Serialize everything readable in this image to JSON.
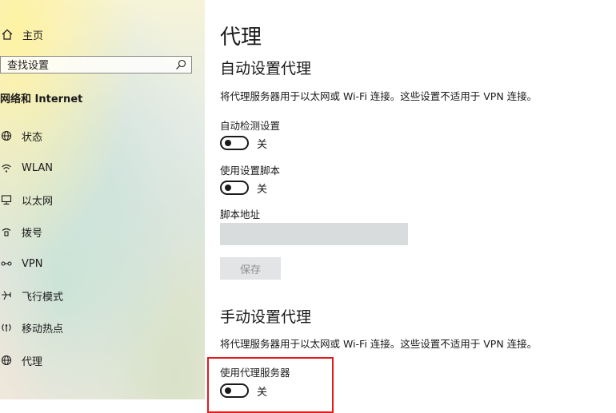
{
  "sidebar": {
    "home_label": "主页",
    "search_placeholder": "查找设置",
    "section_heading": "网络和 Internet",
    "items": [
      {
        "label": "状态",
        "icon": "globe-status-icon"
      },
      {
        "label": "WLAN",
        "icon": "wifi-icon"
      },
      {
        "label": "以太网",
        "icon": "ethernet-icon"
      },
      {
        "label": "拨号",
        "icon": "dialup-icon"
      },
      {
        "label": "VPN",
        "icon": "vpn-icon"
      },
      {
        "label": "飞行模式",
        "icon": "airplane-icon"
      },
      {
        "label": "移动热点",
        "icon": "hotspot-icon"
      },
      {
        "label": "代理",
        "icon": "globe-icon"
      }
    ]
  },
  "main": {
    "title": "代理",
    "auto": {
      "heading": "自动设置代理",
      "description": "将代理服务器用于以太网或 Wi-Fi 连接。这些设置不适用于 VPN 连接。",
      "detect_label": "自动检测设置",
      "detect_state": "关",
      "script_label": "使用设置脚本",
      "script_state": "关",
      "address_label": "脚本地址",
      "address_value": "",
      "save_label": "保存"
    },
    "manual": {
      "heading": "手动设置代理",
      "description": "将代理服务器用于以太网或 Wi-Fi 连接。这些设置不适用于 VPN 连接。",
      "use_proxy_label": "使用代理服务器",
      "use_proxy_state": "关"
    }
  },
  "colors": {
    "highlight": "#e21c1c",
    "input_bg": "#d9dcdd",
    "button_bg": "#e2e4e5",
    "button_text": "#8d8f90"
  }
}
